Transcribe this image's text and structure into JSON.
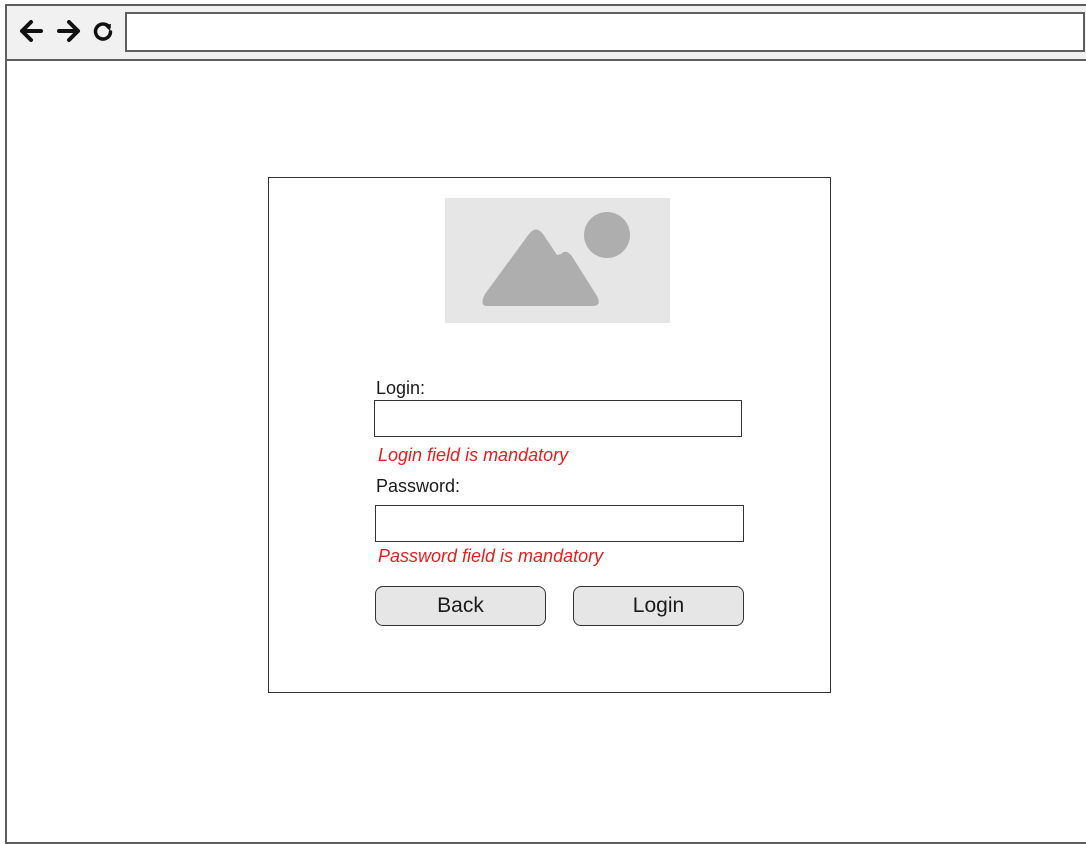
{
  "browser": {
    "address_value": "",
    "nav_icons": [
      "back-arrow-icon",
      "forward-arrow-icon",
      "reload-icon"
    ]
  },
  "login_form": {
    "image_icon": "image-placeholder-icon",
    "login_label": "Login:",
    "login_value": "",
    "login_error": "Login field is mandatory",
    "password_label": "Password:",
    "password_value": "",
    "password_error": "Password field is mandatory",
    "back_button": "Back",
    "login_button": "Login"
  },
  "colors": {
    "error": "#e02020",
    "button_bg": "#e6e6e6",
    "placeholder_bg": "#e6e6e6",
    "placeholder_shape": "#aeaeae"
  }
}
